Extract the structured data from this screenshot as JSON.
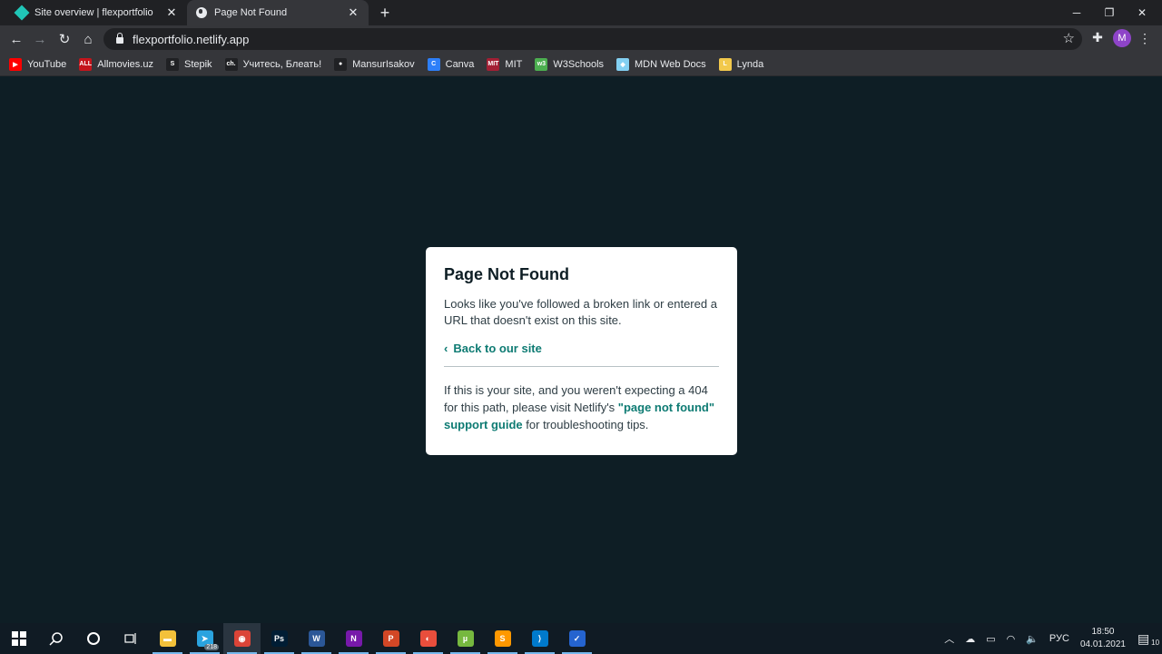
{
  "browser": {
    "tabs": [
      {
        "title": "Site overview | flexportfolio",
        "favicon": "netlify-icon",
        "active": false
      },
      {
        "title": "Page Not Found",
        "favicon": "globe-icon",
        "active": true
      }
    ],
    "url": "flexportfolio.netlify.app",
    "profile_initial": "M",
    "bookmarks": [
      {
        "label": "YouTube",
        "icon": "youtube-icon",
        "color": "#ff0000",
        "glyph": "▶"
      },
      {
        "label": "Allmovies.uz",
        "icon": "allmovies-icon",
        "color": "#c4151c",
        "glyph": "ALL"
      },
      {
        "label": "Stepik",
        "icon": "stepik-icon",
        "color": "#202124",
        "glyph": "S"
      },
      {
        "label": "Учитесь, Блеать!",
        "icon": "ch-icon",
        "color": "#202124",
        "glyph": "ch."
      },
      {
        "label": "MansurIsakov",
        "icon": "github-icon",
        "color": "#202124",
        "glyph": "●"
      },
      {
        "label": "Canva",
        "icon": "canva-icon",
        "color": "#2d7ff9",
        "glyph": "C"
      },
      {
        "label": "MIT",
        "icon": "mit-icon",
        "color": "#a31f34",
        "glyph": "MIT"
      },
      {
        "label": "W3Schools",
        "icon": "w3schools-icon",
        "color": "#4caf50",
        "glyph": "w3"
      },
      {
        "label": "MDN Web Docs",
        "icon": "mdn-icon",
        "color": "#83d0f2",
        "glyph": "◆"
      },
      {
        "label": "Lynda",
        "icon": "lynda-icon",
        "color": "#f2c94c",
        "glyph": "L"
      }
    ]
  },
  "card": {
    "title": "Page Not Found",
    "description": "Looks like you've followed a broken link or entered a URL that doesn't exist on this site.",
    "back_link": "Back to our site",
    "note_before": "If this is your site, and you weren't expecting a 404 for this path, please visit Netlify's ",
    "note_link": "\"page not found\" support guide",
    "note_after": " for troubleshooting tips.",
    "accent_color": "#0e7b73"
  },
  "taskbar": {
    "apps": [
      {
        "name": "file-explorer-icon",
        "color": "#f3c13a",
        "glyph": "▬"
      },
      {
        "name": "telegram-icon",
        "color": "#2aa3df",
        "glyph": "➤"
      },
      {
        "name": "chrome-icon",
        "color": "#db4437",
        "glyph": "◉"
      },
      {
        "name": "photoshop-icon",
        "color": "#001d34",
        "glyph": "Ps"
      },
      {
        "name": "word-icon",
        "color": "#2b5797",
        "glyph": "W"
      },
      {
        "name": "onenote-icon",
        "color": "#7719aa",
        "glyph": "N"
      },
      {
        "name": "powerpoint-icon",
        "color": "#d24726",
        "glyph": "P"
      },
      {
        "name": "pride-app-icon",
        "color": "#e94e3c",
        "glyph": "◐"
      },
      {
        "name": "utorrent-icon",
        "color": "#76b83f",
        "glyph": "µ"
      },
      {
        "name": "sublime-icon",
        "color": "#ff9800",
        "glyph": "S"
      },
      {
        "name": "vscode-icon",
        "color": "#007acc",
        "glyph": "⟩"
      },
      {
        "name": "todo-icon",
        "color": "#2564cf",
        "glyph": "✓"
      }
    ],
    "telegram_badge": "218",
    "language": "РУС",
    "time": "18:50",
    "date": "04.01.2021",
    "notifications": "10"
  }
}
